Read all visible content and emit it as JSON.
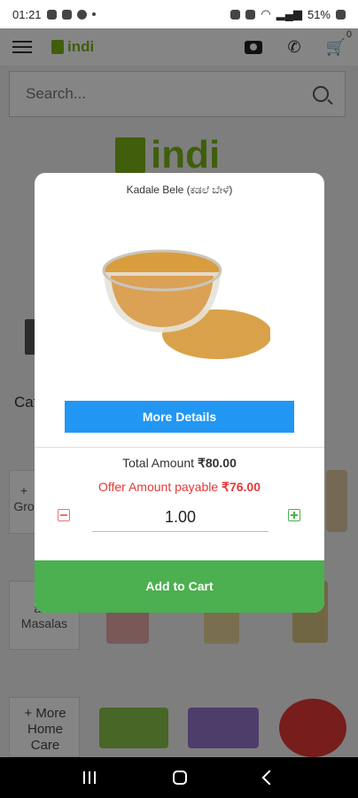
{
  "status_bar": {
    "time": "01:21",
    "battery": "51%"
  },
  "app": {
    "logo_text": "indi",
    "cart_count": "0"
  },
  "search": {
    "placeholder": "Search..."
  },
  "background": {
    "categories_label": "Cat",
    "tile1_text": "+\nGro",
    "tile2_text": "+\nand\nMasalas",
    "more_home_care": "+ More\nHome\nCare"
  },
  "modal": {
    "title": "Kadale Bele (ಕಡಲೆ ಬೇಳೆ)",
    "more_details_label": "More Details",
    "total_label": "Total Amount ",
    "total_value": "₹80.00",
    "offer_label": "Offer Amount payable ",
    "offer_value": "₹76.00",
    "quantity": "1.00",
    "add_to_cart_label": "Add to Cart"
  },
  "colors": {
    "primary_blue": "#2196f3",
    "primary_green": "#4caf50",
    "offer_red": "#e53935",
    "brand_green": "#7cb518"
  }
}
